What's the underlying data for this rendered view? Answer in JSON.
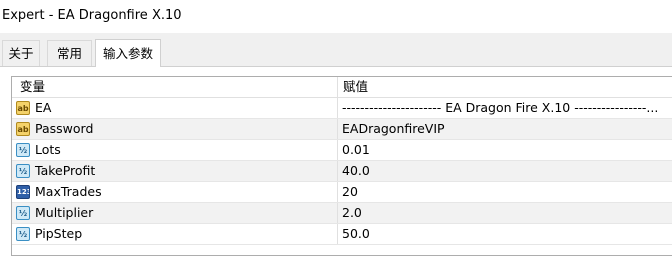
{
  "window": {
    "title": "Expert - EA Dragonfire X.10"
  },
  "tabs": [
    {
      "label": "关于",
      "active": false
    },
    {
      "label": "常用",
      "active": false
    },
    {
      "label": "输入参数",
      "active": true
    }
  ],
  "table": {
    "headers": {
      "variable": "变量",
      "value": "赋值"
    },
    "rows": [
      {
        "icon": "string-icon",
        "icon_text": "ab",
        "name": "EA",
        "value": "---------------------- EA Dragon Fire X.10 ----------------..."
      },
      {
        "icon": "string-icon",
        "icon_text": "ab",
        "name": "Password",
        "value": "EADragonfireVIP"
      },
      {
        "icon": "double-icon",
        "icon_text": "½",
        "name": "Lots",
        "value": "0.01"
      },
      {
        "icon": "double-icon",
        "icon_text": "½",
        "name": "TakeProfit",
        "value": "40.0"
      },
      {
        "icon": "integer-icon",
        "icon_text": "123",
        "name": "MaxTrades",
        "value": "20"
      },
      {
        "icon": "double-icon",
        "icon_text": "½",
        "name": "Multiplier",
        "value": "2.0"
      },
      {
        "icon": "double-icon",
        "icon_text": "½",
        "name": "PipStep",
        "value": "50.0"
      }
    ]
  },
  "colors": {
    "string_icon": "#f4d26a",
    "double_icon": "#cfe9f7",
    "integer_icon": "#2f5fa8",
    "alt_row": "#f2f2f2"
  }
}
